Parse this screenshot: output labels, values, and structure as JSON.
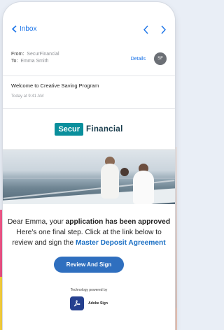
{
  "nav": {
    "back_label": "Inbox"
  },
  "header": {
    "from_label": "From:",
    "from_value": "SecurFinancial",
    "to_label": "To:",
    "to_value": "Emma  Smith",
    "details_label": "Details",
    "avatar_initials": "SF"
  },
  "subject": {
    "title": "Welcome to Creative Saving Program",
    "time": "Today at 9:41 AM"
  },
  "brand": {
    "logo_left": "Secur",
    "logo_right": "Financial"
  },
  "body": {
    "line1_pre": "Dear Emma, your ",
    "line1_bold": "application has been approved",
    "line2": "Here's one final step. Click at the link below to",
    "line3_pre": "review and sign the ",
    "line3_link": "Master Deposit Agreement",
    "cta": "Review And Sign"
  },
  "footer": {
    "powered": "Technology powered by",
    "product": "Adobe Sign"
  },
  "colors": {
    "accent": "#1a73e8",
    "button": "#2f6fbf",
    "brand_teal": "#0a8f9c"
  }
}
